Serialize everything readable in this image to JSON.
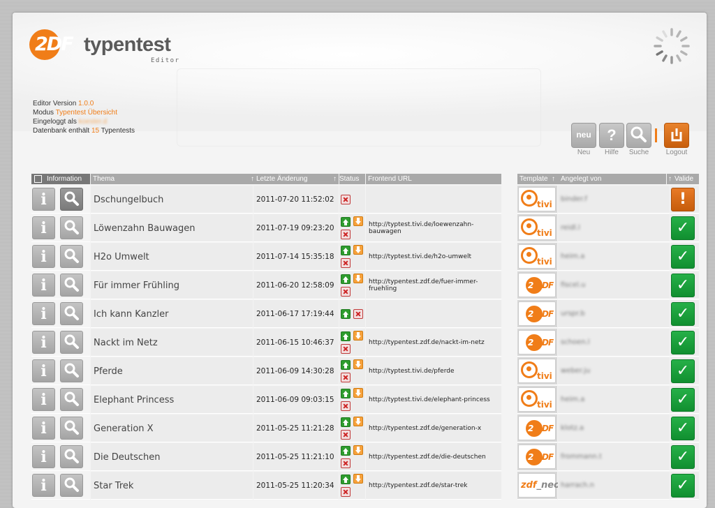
{
  "app": {
    "logo_zdf": "2DF",
    "logo_title": "typentest",
    "logo_subtitle": "Editor"
  },
  "info": {
    "version_label": "Editor Version",
    "version_value": "1.0.0",
    "mode_label": "Modus",
    "mode_value": "Typentest Übersicht",
    "login_label": "Eingeloggt als",
    "login_value": "koester.d",
    "db_prefix": "Datenbank enthält",
    "db_count": "15",
    "db_suffix": "Typentests"
  },
  "toolbar": {
    "new_label": "Neu",
    "new_glyph": "neu",
    "help_label": "Hilfe",
    "search_label": "Suche",
    "logout_label": "Logout"
  },
  "table": {
    "headers": {
      "information": "Information",
      "thema": "Thema",
      "letzte_aenderung": "Letzte Änderung",
      "status": "Status",
      "frontend_url": "Frontend URL",
      "template": "Template",
      "angelegt_von": "Angelegt von",
      "valide": "Valide"
    },
    "rows": [
      {
        "thema": "Dschungelbuch",
        "date": "2011-07-20 11:52:02",
        "url1": "",
        "url2": "",
        "template": "tivi",
        "user": "binder.f",
        "valid": "err",
        "status": "x",
        "search_active": true
      },
      {
        "thema": "Löwenzahn Bauwagen",
        "date": "2011-07-19 09:23:20",
        "url1": "http://typtest.tivi.de/loewenzahn-",
        "url2": "bauwagen",
        "template": "tivi",
        "user": "reidl.l",
        "valid": "ok",
        "status": "full",
        "search_active": false
      },
      {
        "thema": "H2o Umwelt",
        "date": "2011-07-14 15:35:18",
        "url1": "http://typtest.tivi.de/h2o-umwelt",
        "url2": "",
        "template": "tivi",
        "user": "heim.a",
        "valid": "ok",
        "status": "full",
        "search_active": false
      },
      {
        "thema": "Für immer Frühling",
        "date": "2011-06-20 12:58:09",
        "url1": "http://typentest.zdf.de/fuer-immer-",
        "url2": "fruehling",
        "template": "zdf",
        "user": "fiscel.u",
        "valid": "ok",
        "status": "full",
        "search_active": false
      },
      {
        "thema": "Ich kann Kanzler",
        "date": "2011-06-17 17:19:44",
        "url1": "",
        "url2": "",
        "template": "zdf",
        "user": "urspr.b",
        "valid": "ok",
        "status": "upx",
        "search_active": false
      },
      {
        "thema": "Nackt im Netz",
        "date": "2011-06-15 10:46:37",
        "url1": "http://typentest.zdf.de/nackt-im-netz",
        "url2": "",
        "template": "zdf",
        "user": "schoen.l",
        "valid": "ok",
        "status": "full",
        "search_active": false
      },
      {
        "thema": "Pferde",
        "date": "2011-06-09 14:30:28",
        "url1": "http://typtest.tivi.de/pferde",
        "url2": "",
        "template": "tivi",
        "user": "weber.ju",
        "valid": "ok",
        "status": "full",
        "search_active": false
      },
      {
        "thema": "Elephant Princess",
        "date": "2011-06-09 09:03:15",
        "url1": "http://typtest.tivi.de/elephant-princess",
        "url2": "",
        "template": "tivi",
        "user": "heim.a",
        "valid": "ok",
        "status": "full",
        "search_active": false
      },
      {
        "thema": "Generation X",
        "date": "2011-05-25 11:21:28",
        "url1": "http://typentest.zdf.de/generation-x",
        "url2": "",
        "template": "zdf",
        "user": "klotz.a",
        "valid": "ok",
        "status": "full",
        "search_active": false
      },
      {
        "thema": "Die Deutschen",
        "date": "2011-05-25 11:21:10",
        "url1": "http://typentest.zdf.de/die-deutschen",
        "url2": "",
        "template": "zdf",
        "user": "frommann.t",
        "valid": "ok",
        "status": "full",
        "search_active": false
      },
      {
        "thema": "Star Trek",
        "date": "2011-05-25 11:20:34",
        "url1": "http://typentest.zdf.de/star-trek",
        "url2": "",
        "template": "neo",
        "user": "harrach.n",
        "valid": "ok",
        "status": "full",
        "search_active": false
      }
    ]
  },
  "template_text": {
    "zdf_a": "2",
    "zdf_b": "DF",
    "tivi": "tivi",
    "neo_a": "zdf",
    "neo_b": "_neo"
  },
  "glyphs": {
    "info": "i",
    "ok": "✓",
    "err": "!"
  },
  "colors": {
    "accent": "#f07d18",
    "valid_ok": "#1aa03a",
    "valid_err": "#d5671a",
    "header_bg": "#a9a9a9"
  }
}
